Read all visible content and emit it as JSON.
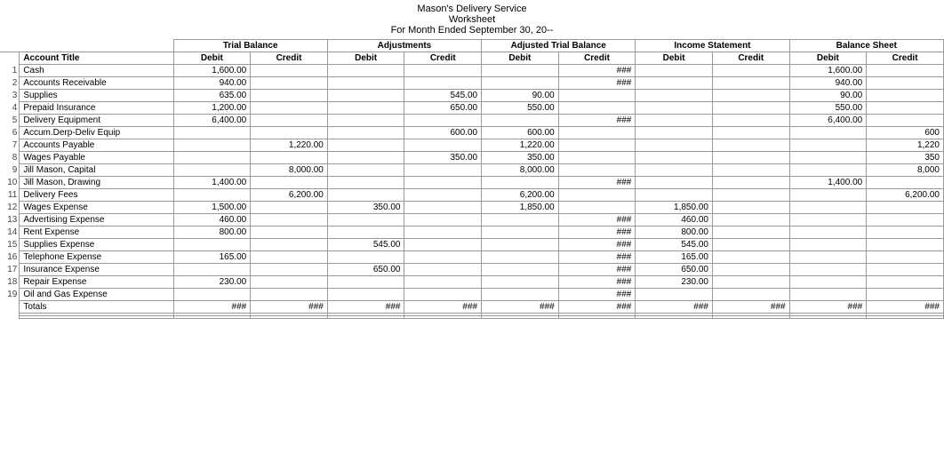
{
  "header": {
    "line1": "Mason's Delivery Service",
    "line2": "Worksheet",
    "line3": "For Month Ended September 30, 20--"
  },
  "columns": {
    "accountTitle": "Account Title",
    "trialBalance": "Trial Balance",
    "adjustments": "Adjustments",
    "adjustedTrialBalance": "Adjusted Trial Balance",
    "incomeStatement": "Income Statement",
    "balanceSheet": "Balance Sheet",
    "debit": "Debit",
    "credit": "Credit"
  },
  "rows": [
    {
      "num": "1",
      "account": "Cash",
      "tb_d": "1,600.00",
      "tb_c": "",
      "adj_d": "",
      "adj_c": "",
      "atb_d": "",
      "atb_c": "###",
      "is_d": "",
      "is_c": "",
      "bs_d": "1,600.00",
      "bs_c": ""
    },
    {
      "num": "2",
      "account": "Accounts Receivable",
      "tb_d": "940.00",
      "tb_c": "",
      "adj_d": "",
      "adj_c": "",
      "atb_d": "",
      "atb_c": "###",
      "is_d": "",
      "is_c": "",
      "bs_d": "940.00",
      "bs_c": ""
    },
    {
      "num": "3",
      "account": "Supplies",
      "tb_d": "635.00",
      "tb_c": "",
      "adj_d": "",
      "adj_c": "545.00",
      "atb_d": "90.00",
      "atb_c": "",
      "is_d": "",
      "is_c": "",
      "bs_d": "90.00",
      "bs_c": ""
    },
    {
      "num": "4",
      "account": "Prepaid Insurance",
      "tb_d": "1,200.00",
      "tb_c": "",
      "adj_d": "",
      "adj_c": "650.00",
      "atb_d": "550.00",
      "atb_c": "",
      "is_d": "",
      "is_c": "",
      "bs_d": "550.00",
      "bs_c": ""
    },
    {
      "num": "5",
      "account": "Delivery Equipment",
      "tb_d": "6,400.00",
      "tb_c": "",
      "adj_d": "",
      "adj_c": "",
      "atb_d": "",
      "atb_c": "###",
      "is_d": "",
      "is_c": "",
      "bs_d": "6,400.00",
      "bs_c": ""
    },
    {
      "num": "6",
      "account": "Accum.Derp-Deliv Equip",
      "tb_d": "",
      "tb_c": "",
      "adj_d": "",
      "adj_c": "600.00",
      "atb_d": "600.00",
      "atb_c": "",
      "is_d": "",
      "is_c": "",
      "bs_d": "",
      "bs_c": "600"
    },
    {
      "num": "7",
      "account": "Accounts Payable",
      "tb_d": "",
      "tb_c": "1,220.00",
      "adj_d": "",
      "adj_c": "",
      "atb_d": "1,220.00",
      "atb_c": "",
      "is_d": "",
      "is_c": "",
      "bs_d": "",
      "bs_c": "1,220"
    },
    {
      "num": "8",
      "account": "Wages Payable",
      "tb_d": "",
      "tb_c": "",
      "adj_d": "",
      "adj_c": "350.00",
      "atb_d": "350.00",
      "atb_c": "",
      "is_d": "",
      "is_c": "",
      "bs_d": "",
      "bs_c": "350"
    },
    {
      "num": "9",
      "account": "Jill Mason, Capital",
      "tb_d": "",
      "tb_c": "8,000.00",
      "adj_d": "",
      "adj_c": "",
      "atb_d": "8,000.00",
      "atb_c": "",
      "is_d": "",
      "is_c": "",
      "bs_d": "",
      "bs_c": "8,000"
    },
    {
      "num": "10",
      "account": "Jill Mason, Drawing",
      "tb_d": "1,400.00",
      "tb_c": "",
      "adj_d": "",
      "adj_c": "",
      "atb_d": "",
      "atb_c": "###",
      "is_d": "",
      "is_c": "",
      "bs_d": "1,400.00",
      "bs_c": ""
    },
    {
      "num": "11",
      "account": "Delivery Fees",
      "tb_d": "",
      "tb_c": "6,200.00",
      "adj_d": "",
      "adj_c": "",
      "atb_d": "6,200.00",
      "atb_c": "",
      "is_d": "",
      "is_c": "",
      "bs_d": "",
      "bs_c": "6,200.00"
    },
    {
      "num": "12",
      "account": "Wages Expense",
      "tb_d": "1,500.00",
      "tb_c": "",
      "adj_d": "350.00",
      "adj_c": "",
      "atb_d": "1,850.00",
      "atb_c": "",
      "is_d": "1,850.00",
      "is_c": "",
      "bs_d": "",
      "bs_c": ""
    },
    {
      "num": "13",
      "account": "Advertising Expense",
      "tb_d": "460.00",
      "tb_c": "",
      "adj_d": "",
      "adj_c": "",
      "atb_d": "",
      "atb_c": "###",
      "is_d": "460.00",
      "is_c": "",
      "bs_d": "",
      "bs_c": ""
    },
    {
      "num": "14",
      "account": "Rent Expense",
      "tb_d": "800.00",
      "tb_c": "",
      "adj_d": "",
      "adj_c": "",
      "atb_d": "",
      "atb_c": "###",
      "is_d": "800.00",
      "is_c": "",
      "bs_d": "",
      "bs_c": ""
    },
    {
      "num": "15",
      "account": "Supplies Expense",
      "tb_d": "",
      "tb_c": "",
      "adj_d": "545.00",
      "adj_c": "",
      "atb_d": "",
      "atb_c": "###",
      "is_d": "545.00",
      "is_c": "",
      "bs_d": "",
      "bs_c": ""
    },
    {
      "num": "16",
      "account": "Telephone Expense",
      "tb_d": "165.00",
      "tb_c": "",
      "adj_d": "",
      "adj_c": "",
      "atb_d": "",
      "atb_c": "###",
      "is_d": "165.00",
      "is_c": "",
      "bs_d": "",
      "bs_c": ""
    },
    {
      "num": "17",
      "account": "Insurance Expense",
      "tb_d": "",
      "tb_c": "",
      "adj_d": "650.00",
      "adj_c": "",
      "atb_d": "",
      "atb_c": "###",
      "is_d": "650.00",
      "is_c": "",
      "bs_d": "",
      "bs_c": ""
    },
    {
      "num": "18",
      "account": "Repair Expense",
      "tb_d": "230.00",
      "tb_c": "",
      "adj_d": "",
      "adj_c": "",
      "atb_d": "",
      "atb_c": "###",
      "is_d": "230.00",
      "is_c": "",
      "bs_d": "",
      "bs_c": ""
    },
    {
      "num": "19",
      "account": "Oil and Gas Expense",
      "tb_d": "",
      "tb_c": "",
      "adj_d": "",
      "adj_c": "",
      "atb_d": "",
      "atb_c": "###",
      "is_d": "",
      "is_c": "",
      "bs_d": "",
      "bs_c": ""
    }
  ],
  "totals_label": "Totals",
  "totals_tb_d": "###",
  "totals_tb_c": "###",
  "totals_adj_d": "###",
  "totals_adj_c": "###",
  "totals_atb_d": "###",
  "totals_atb_c": "###",
  "totals_is_d": "###",
  "totals_is_c": "###",
  "totals_bs_d": "###",
  "totals_bs_c": "###"
}
